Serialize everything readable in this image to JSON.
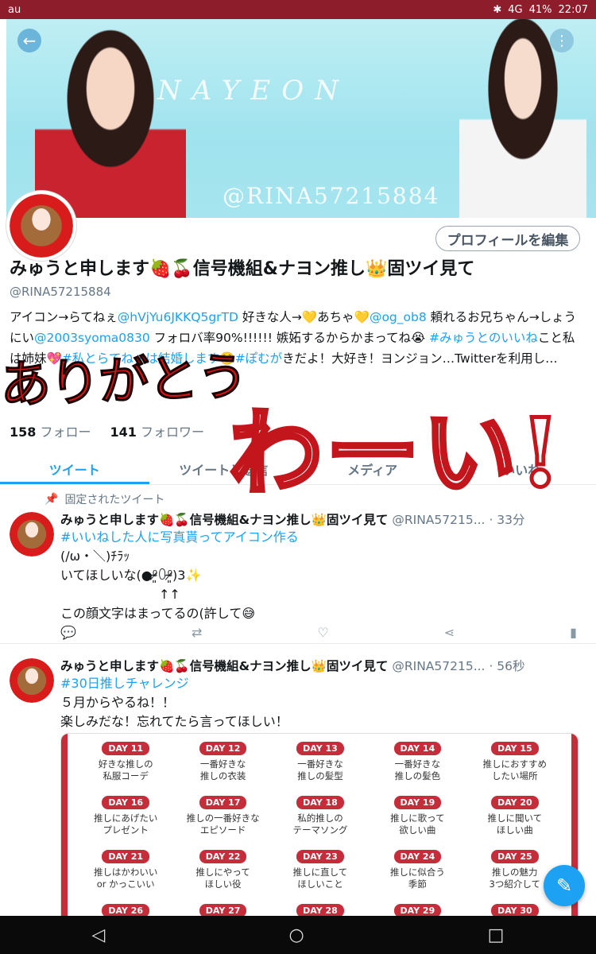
{
  "statusbar": {
    "carrier": "au",
    "battery": "41%",
    "time": "22:07",
    "signal": "4G"
  },
  "banner": {
    "script_text": "NAYEON",
    "handle_text": "@RINA57215884"
  },
  "profile": {
    "edit_label": "プロフィールを編集",
    "display_name": "みゅうと申します🍓🍒信号機組&ナヨン推し👑固ツイ見て",
    "screen_name": "@RINA57215884",
    "bio_parts": {
      "p1": "アイコン→らてねぇ",
      "l1": "@hVjYu6JKKQ5grTD",
      "p2": " 好きな人→💛あちゃ💛",
      "l2": "@og_ob8",
      "p3": " 頼れるお兄ちゃん→しょうにい",
      "l3": "@2003syoma0830",
      "p4": " フォロバ率90%!!!!!! 嫉妬するからかまってね😭 ",
      "l4": "#みゅうとのいいね",
      "p5": "こと私は姉妹💖",
      "l5": "#私とらてねぇは結婚します☺️#ぽむが",
      "p6": "きだよ！大好き！ヨンジョン…Twitterを利用し…"
    },
    "following_count": "158",
    "following_label": "フォロー",
    "followers_count": "141",
    "followers_label": "フォロワー"
  },
  "overlay": {
    "text1": "ありがとう",
    "text2": "わーい!"
  },
  "tabs": [
    {
      "label": "ツイート"
    },
    {
      "label": "ツイートと返信"
    },
    {
      "label": "メディア"
    },
    {
      "label": "いいね"
    }
  ],
  "pinned_label": "固定されたツイート",
  "tweets": [
    {
      "name": "みゅうと申します🍓🍒信号機組&ナヨン推し👑固ツイ見て",
      "handle": "@RINA57215...",
      "time": "· 33分",
      "hashtag": "#いいねした人に写真貰ってアイコン作る",
      "line1": "(/ω・＼)ﾁﾗｯ",
      "line2": "いてほしいな(●⁰̷̴͈꒨⁰̷̴͈)3✨",
      "line3": "↑↑",
      "line4": "この顔文字はまってるの(許して😅"
    },
    {
      "name": "みゅうと申します🍓🍒信号機組&ナヨン推し👑固ツイ見て",
      "handle": "@RINA57215...",
      "time": "· 56秒",
      "hashtag": "#30日推しチャレンジ",
      "line1": "５月からやるね！！",
      "line2": "楽しみだな！忘れてたら言ってほしい！"
    }
  ],
  "calendar": [
    {
      "day": "DAY 11",
      "text": "好きな推しの\n私服コーデ"
    },
    {
      "day": "DAY 12",
      "text": "一番好きな\n推しの衣装"
    },
    {
      "day": "DAY 13",
      "text": "一番好きな\n推しの髪型"
    },
    {
      "day": "DAY 14",
      "text": "一番好きな\n推しの髪色"
    },
    {
      "day": "DAY 15",
      "text": "推しにおすすめ\nしたい場所"
    },
    {
      "day": "DAY 16",
      "text": "推しにあげたい\nプレゼント"
    },
    {
      "day": "DAY 17",
      "text": "推しの一番好きな\nエピソード"
    },
    {
      "day": "DAY 18",
      "text": "私的推しの\nテーマソング"
    },
    {
      "day": "DAY 19",
      "text": "推しに歌って\n欲しい曲"
    },
    {
      "day": "DAY 20",
      "text": "推しに聞いて\nほしい曲"
    },
    {
      "day": "DAY 21",
      "text": "推しはかわいい\nor かっこいい"
    },
    {
      "day": "DAY 22",
      "text": "推しにやって\nほしい役"
    },
    {
      "day": "DAY 23",
      "text": "推しに直して\nほしいこと"
    },
    {
      "day": "DAY 24",
      "text": "推しに似合う\n季節"
    },
    {
      "day": "DAY 25",
      "text": "推しの魅力\n3つ紹介して"
    },
    {
      "day": "DAY 26",
      "text": ""
    },
    {
      "day": "DAY 27",
      "text": ""
    },
    {
      "day": "DAY 28",
      "text": ""
    },
    {
      "day": "DAY 29",
      "text": ""
    },
    {
      "day": "DAY 30",
      "text": ""
    }
  ],
  "colors": {
    "accent": "#1da1f2",
    "statusbar": "#8e1d2c",
    "calendar_red": "#c62d3a"
  }
}
